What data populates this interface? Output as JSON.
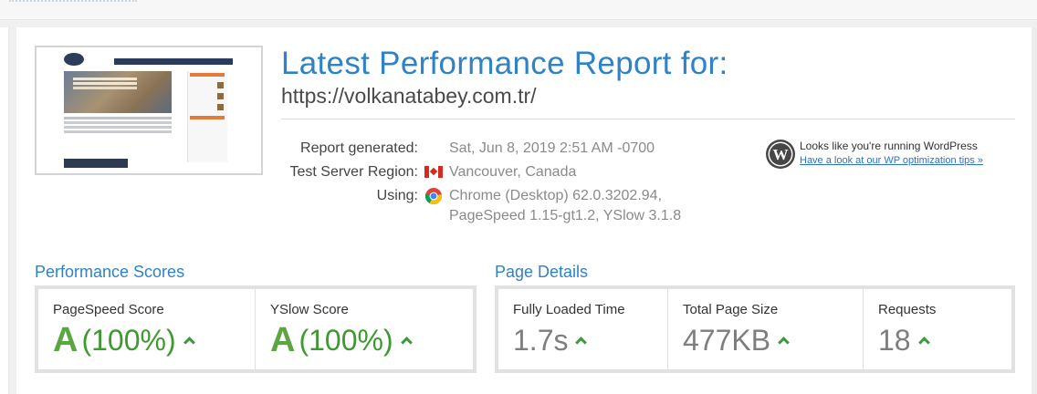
{
  "report": {
    "title": "Latest Performance Report for:",
    "url": "https://volkanatabey.com.tr/"
  },
  "meta": {
    "generated_label": "Report generated:",
    "generated_value": "Sat, Jun 8, 2019 2:51 AM -0700",
    "region_label": "Test Server Region:",
    "region_value": "Vancouver, Canada",
    "using_label": "Using:",
    "using_value_line1": "Chrome (Desktop) 62.0.3202.94,",
    "using_value_line2": "PageSpeed 1.15-gt1.2, YSlow 3.1.8"
  },
  "wordpress": {
    "text": "Looks like you're running WordPress",
    "link": "Have a look at our WP optimization tips »"
  },
  "performance": {
    "title": "Performance Scores",
    "pagespeed_label": "PageSpeed Score",
    "pagespeed_grade": "A",
    "pagespeed_pct": "(100%)",
    "yslow_label": "YSlow Score",
    "yslow_grade": "A",
    "yslow_pct": "(100%)"
  },
  "details": {
    "title": "Page Details",
    "load_label": "Fully Loaded Time",
    "load_value": "1.7s",
    "size_label": "Total Page Size",
    "size_value": "477KB",
    "requests_label": "Requests",
    "requests_value": "18"
  },
  "colors": {
    "accent": "#2f82c5",
    "grade_green": "#5aa742",
    "link": "#2a73c5"
  },
  "icons": [
    "canada-flag-icon",
    "chrome-icon",
    "wordpress-icon",
    "caret-up-icon"
  ]
}
